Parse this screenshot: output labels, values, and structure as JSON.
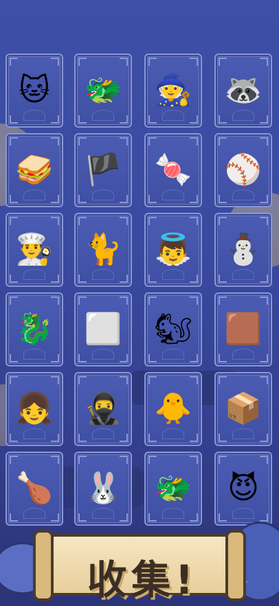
{
  "banner": {
    "title": "收集!"
  },
  "cards": [
    {
      "name": "knight-cat",
      "icon": "🐱"
    },
    {
      "name": "dragon-cat",
      "icon": "🐲"
    },
    {
      "name": "mage-cat",
      "icon": "🧙"
    },
    {
      "name": "raccoon-cat",
      "icon": "🦝"
    },
    {
      "name": "sandwich-cat",
      "icon": "🥪"
    },
    {
      "name": "pirate-cat",
      "icon": "🏴"
    },
    {
      "name": "cotton-candy-cat",
      "icon": "🍬"
    },
    {
      "name": "baseball-cat",
      "icon": "⚾"
    },
    {
      "name": "chef-cat",
      "icon": "👨‍🍳"
    },
    {
      "name": "white-cat",
      "icon": "🐈"
    },
    {
      "name": "angel-knight-cat",
      "icon": "👼"
    },
    {
      "name": "snowman-cat",
      "icon": "⛄"
    },
    {
      "name": "blue-dragon-cat",
      "icon": "🐉"
    },
    {
      "name": "cube-cat",
      "icon": "⬜"
    },
    {
      "name": "squirrel-cat",
      "icon": "🐿"
    },
    {
      "name": "block-cat",
      "icon": "🟫"
    },
    {
      "name": "twins-cat",
      "icon": "👧"
    },
    {
      "name": "ninja-cat",
      "icon": "🥷"
    },
    {
      "name": "chick-cat",
      "icon": "🐥"
    },
    {
      "name": "box-cat",
      "icon": "📦"
    },
    {
      "name": "roast-turkey-cat",
      "icon": "🍗"
    },
    {
      "name": "bunny-cat",
      "icon": "🐰"
    },
    {
      "name": "sea-dragon-cat",
      "icon": "🐲"
    },
    {
      "name": "devil-cat",
      "icon": "😈"
    }
  ]
}
